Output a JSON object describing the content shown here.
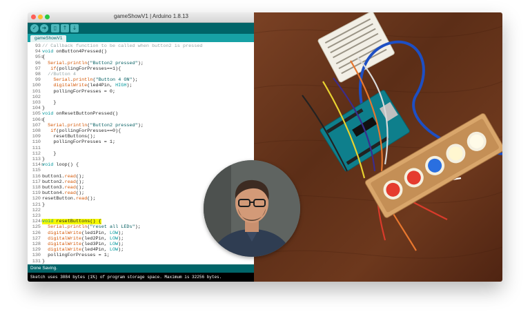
{
  "window": {
    "title": "gameShowV1 | Arduino 1.8.13"
  },
  "toolbar": {
    "buttons": [
      {
        "name": "verify",
        "glyph": "✓"
      },
      {
        "name": "upload",
        "glyph": "➜"
      },
      {
        "name": "new",
        "glyph": "▯"
      },
      {
        "name": "open",
        "glyph": "↑"
      },
      {
        "name": "save",
        "glyph": "↓"
      }
    ]
  },
  "tab": {
    "label": "gameShowV1"
  },
  "code_lines": [
    {
      "n": "93",
      "text": "// Callback function to be called when button2 is pressed"
    },
    {
      "n": "94",
      "text": "void onButton4Pressed()"
    },
    {
      "n": "95",
      "text": "{"
    },
    {
      "n": "96",
      "text": "  Serial.println(\"Button2 pressed\");"
    },
    {
      "n": "97",
      "text": "   if(pollingForPresses==1){"
    },
    {
      "n": "98",
      "text": "  //Button 4"
    },
    {
      "n": "99",
      "text": "    Serial.println(\"Button 4 ON\");"
    },
    {
      "n": "100",
      "text": "    digitalWrite(led4Pin, HIGH);"
    },
    {
      "n": "101",
      "text": "    pollingForPresses = 0;"
    },
    {
      "n": "102",
      "text": ""
    },
    {
      "n": "103",
      "text": "    }"
    },
    {
      "n": "104",
      "text": "}"
    },
    {
      "n": "105",
      "text": "void onResetButtonPressed()"
    },
    {
      "n": "106",
      "text": "{"
    },
    {
      "n": "107",
      "text": "  Serial.println(\"Button2 pressed\");"
    },
    {
      "n": "108",
      "text": "   if(pollingForPresses==0){"
    },
    {
      "n": "109",
      "text": "    resetButtons();"
    },
    {
      "n": "110",
      "text": "    pollingForPresses = 1;"
    },
    {
      "n": "111",
      "text": ""
    },
    {
      "n": "112",
      "text": "    }"
    },
    {
      "n": "113",
      "text": "}"
    },
    {
      "n": "114",
      "text": "void loop() {"
    },
    {
      "n": "115",
      "text": ""
    },
    {
      "n": "116",
      "text": "button1.read();"
    },
    {
      "n": "117",
      "text": "button2.read();"
    },
    {
      "n": "118",
      "text": "button3.read();"
    },
    {
      "n": "119",
      "text": "button4.read();"
    },
    {
      "n": "120",
      "text": "resetButton.read();"
    },
    {
      "n": "121",
      "text": "}"
    },
    {
      "n": "122",
      "text": ""
    },
    {
      "n": "123",
      "text": ""
    },
    {
      "n": "124",
      "text": "void resetButtons() {"
    },
    {
      "n": "125",
      "text": "  Serial.println(\"reset all LEDs\");"
    },
    {
      "n": "126",
      "text": "  digitalWrite(led1Pin, LOW);"
    },
    {
      "n": "127",
      "text": "  digitalWrite(led2Pin, LOW);"
    },
    {
      "n": "128",
      "text": "  digitalWrite(led3Pin, LOW);"
    },
    {
      "n": "129",
      "text": "  digitalWrite(led4Pin, LOW);"
    },
    {
      "n": "130",
      "text": "  pollingForPresses = 1;"
    },
    {
      "n": "131",
      "text": "}"
    }
  ],
  "status": {
    "text": "Done Saving."
  },
  "console": {
    "text": "Sketch uses 3084 bytes (1%) of program storage space. Maximum is 32256 bytes."
  },
  "colors": {
    "arduino_dark_teal": "#006468",
    "arduino_teal": "#17a1a5",
    "highlight": "#f4f700"
  }
}
